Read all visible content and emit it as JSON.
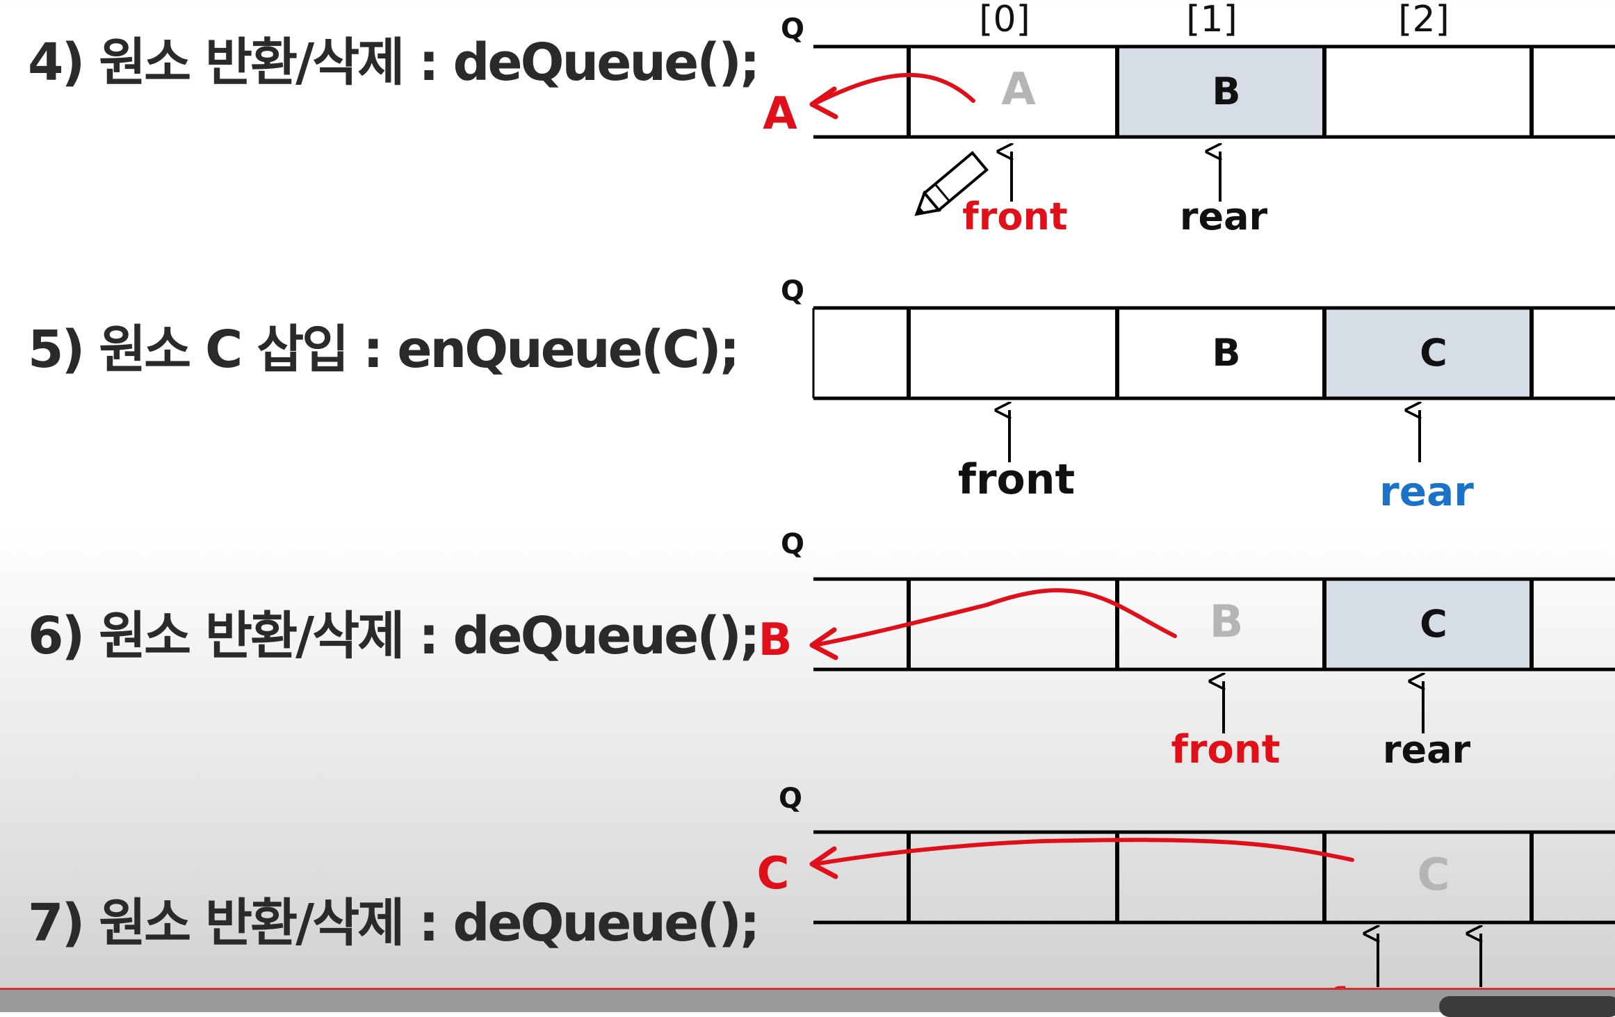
{
  "queue_label": "Q",
  "indices": [
    "[0]",
    "[1]",
    "[2]"
  ],
  "pointer_labels": {
    "front": "front",
    "rear": "rear"
  },
  "colors": {
    "highlight": "#d7dde7",
    "removed_text": "#b5b5b5",
    "arrow_red": "#e0101a",
    "rear_blue": "#1a73c8",
    "line": "#000000"
  },
  "steps": [
    {
      "label": "4) 원소 반환/삭제 : deQueue();",
      "cells": [
        {
          "value": "",
          "state": "normal"
        },
        {
          "value": "A",
          "state": "removed"
        },
        {
          "value": "B",
          "state": "highlight"
        },
        {
          "value": "",
          "state": "normal"
        },
        {
          "value": "",
          "state": "normal"
        }
      ],
      "output": "A",
      "front_cell": 1,
      "front_color": "red",
      "rear_cell": 2,
      "rear_color": "black"
    },
    {
      "label": "5) 원소 C 삽입 : enQueue(C);",
      "cells": [
        {
          "value": "",
          "state": "normal"
        },
        {
          "value": "",
          "state": "normal"
        },
        {
          "value": "B",
          "state": "normal"
        },
        {
          "value": "C",
          "state": "highlight"
        },
        {
          "value": "",
          "state": "normal"
        }
      ],
      "output": "",
      "front_cell": 1,
      "front_color": "black",
      "rear_cell": 3,
      "rear_color": "blue"
    },
    {
      "label": "6) 원소 반환/삭제 : deQueue();",
      "cells": [
        {
          "value": "",
          "state": "normal"
        },
        {
          "value": "",
          "state": "normal"
        },
        {
          "value": "B",
          "state": "removed"
        },
        {
          "value": "C",
          "state": "highlight"
        },
        {
          "value": "",
          "state": "normal"
        }
      ],
      "output": "B",
      "front_cell": 2,
      "front_color": "red",
      "rear_cell": 3,
      "rear_color": "black"
    },
    {
      "label": "7) 원소 반환/삭제 : deQueue();",
      "cells": [
        {
          "value": "",
          "state": "normal"
        },
        {
          "value": "",
          "state": "normal"
        },
        {
          "value": "",
          "state": "normal"
        },
        {
          "value": "C",
          "state": "removed"
        },
        {
          "value": "",
          "state": "normal"
        }
      ],
      "output": "C",
      "front_cell": 3,
      "front_color": "red",
      "rear_cell": 3,
      "rear_color": "red"
    }
  ]
}
